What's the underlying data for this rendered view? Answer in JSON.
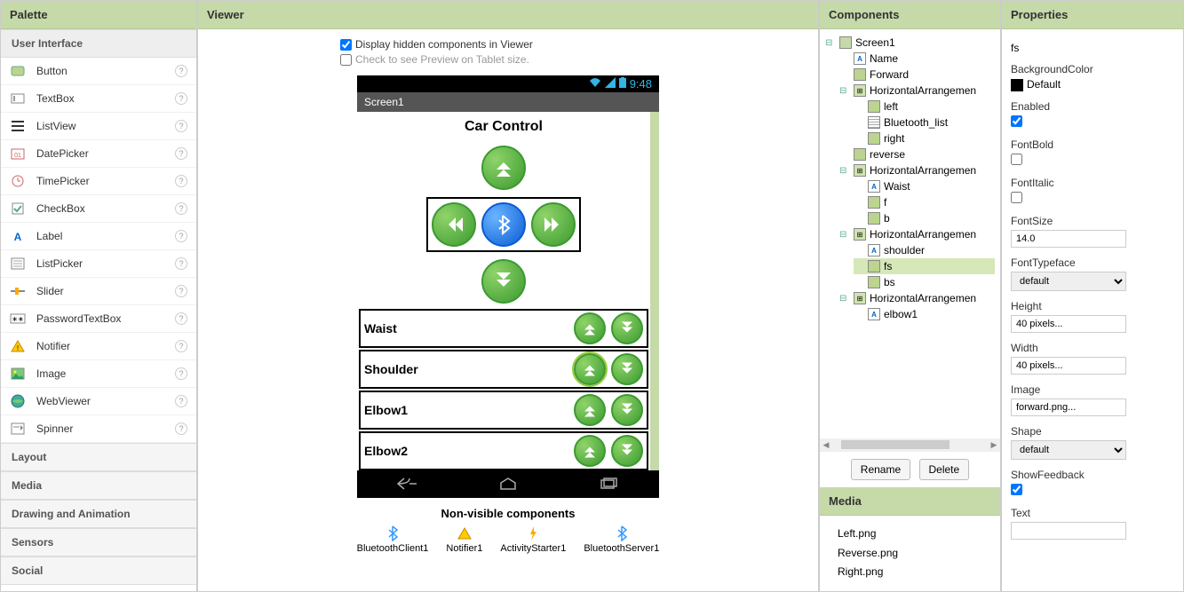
{
  "palette": {
    "title": "Palette",
    "sections": {
      "ui": "User Interface",
      "layout": "Layout",
      "media": "Media",
      "drawing": "Drawing and Animation",
      "sensors": "Sensors",
      "social": "Social"
    },
    "ui_items": [
      {
        "label": "Button",
        "icon": "button-icon"
      },
      {
        "label": "TextBox",
        "icon": "textbox-icon"
      },
      {
        "label": "ListView",
        "icon": "listview-icon"
      },
      {
        "label": "DatePicker",
        "icon": "datepicker-icon"
      },
      {
        "label": "TimePicker",
        "icon": "timepicker-icon"
      },
      {
        "label": "CheckBox",
        "icon": "checkbox-icon"
      },
      {
        "label": "Label",
        "icon": "label-icon"
      },
      {
        "label": "ListPicker",
        "icon": "listpicker-icon"
      },
      {
        "label": "Slider",
        "icon": "slider-icon"
      },
      {
        "label": "PasswordTextBox",
        "icon": "password-icon"
      },
      {
        "label": "Notifier",
        "icon": "notifier-icon"
      },
      {
        "label": "Image",
        "icon": "image-icon"
      },
      {
        "label": "WebViewer",
        "icon": "webviewer-icon"
      },
      {
        "label": "Spinner",
        "icon": "spinner-icon"
      }
    ]
  },
  "viewer": {
    "title": "Viewer",
    "display_hidden_label": "Display hidden components in Viewer",
    "tablet_preview_label": "Check to see Preview on Tablet size.",
    "display_hidden_checked": true,
    "tablet_preview_checked": false,
    "status_time": "9:48",
    "screen_title": "Screen1",
    "app_title": "Car Control",
    "joints": [
      "Waist",
      "Shoulder",
      "Elbow1",
      "Elbow2"
    ],
    "nonvis_title": "Non-visible components",
    "nonvis": [
      "BluetoothClient1",
      "Notifier1",
      "ActivityStarter1",
      "BluetoothServer1"
    ]
  },
  "components": {
    "title": "Components",
    "tree": {
      "screen": "Screen1",
      "name": "Name",
      "forward": "Forward",
      "ha1": "HorizontalArrangemen",
      "left": "left",
      "btlist": "Bluetooth_list",
      "right": "right",
      "reverse": "reverse",
      "ha2": "HorizontalArrangemen",
      "waist": "Waist",
      "f": "f",
      "b": "b",
      "ha3": "HorizontalArrangemen",
      "shoulder": "shoulder",
      "fs": "fs",
      "bs": "bs",
      "ha4": "HorizontalArrangemen",
      "elbow1": "elbow1"
    },
    "rename": "Rename",
    "delete": "Delete",
    "media_title": "Media",
    "media_files": [
      "Left.png",
      "Reverse.png",
      "Right.png"
    ]
  },
  "properties": {
    "title": "Properties",
    "selected": "fs",
    "fields": {
      "BackgroundColor": "Default",
      "Enabled": true,
      "FontBold": false,
      "FontItalic": false,
      "FontSize": "14.0",
      "FontTypeface": "default",
      "Height": "40 pixels...",
      "Width": "40 pixels...",
      "Image": "forward.png...",
      "Shape": "default",
      "ShowFeedback": true,
      "Text": ""
    },
    "labels": {
      "BackgroundColor": "BackgroundColor",
      "Enabled": "Enabled",
      "FontBold": "FontBold",
      "FontItalic": "FontItalic",
      "FontSize": "FontSize",
      "FontTypeface": "FontTypeface",
      "Height": "Height",
      "Width": "Width",
      "Image": "Image",
      "Shape": "Shape",
      "ShowFeedback": "ShowFeedback",
      "Text": "Text"
    }
  }
}
